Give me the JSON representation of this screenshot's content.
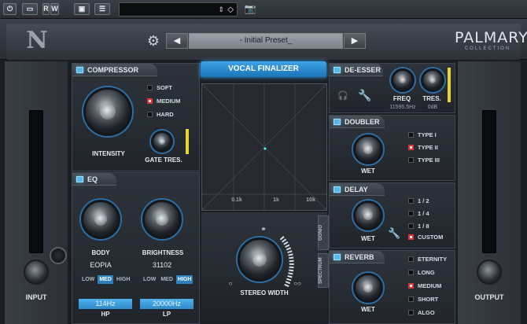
{
  "host": {
    "buttons": [
      "R",
      "W"
    ],
    "select_value": ""
  },
  "header": {
    "preset_name": "- Initial Preset_",
    "prev_arrow": "◀",
    "next_arrow": "▶",
    "brand_line1": "PALMARY",
    "brand_line2": "COLLECTION"
  },
  "input": {
    "label": "INPUT"
  },
  "output": {
    "label": "OUTPUT"
  },
  "title": "VOCAL FINALIZER",
  "compressor": {
    "title": "COMPRESSOR",
    "options": [
      "SOFT",
      "MEDIUM",
      "HARD"
    ],
    "selected": "MEDIUM",
    "intensity_label": "INTENSITY",
    "gate_label": "GATE TRES."
  },
  "eq": {
    "title": "EQ",
    "body_label": "BODY",
    "body_value": "EOPIA",
    "brightness_label": "BRIGHTNESS",
    "brightness_value": "31102",
    "body_bands": [
      "LOW",
      "MED",
      "HIGH"
    ],
    "body_selected": "MED",
    "brightness_bands": [
      "LOW",
      "MED",
      "HIGH"
    ],
    "brightness_selected": "HIGH",
    "hp_value": "114Hz",
    "hp_label": "HP",
    "lp_value": "20000Hz",
    "lp_label": "LP"
  },
  "display": {
    "freq_labels": [
      "0.1k",
      "1k",
      "10k"
    ],
    "tab_gonio": "GONIO",
    "tab_spectrum": "SPECTRUM"
  },
  "stereo": {
    "label": "STEREO WIDTH"
  },
  "deesser": {
    "title": "DE-ESSER",
    "freq_label": "FREQ",
    "freq_value": "11595.5Hz",
    "tres_label": "TRES.",
    "tres_value": "0dB"
  },
  "doubler": {
    "title": "DOUBLER",
    "wet_label": "WET",
    "options": [
      "TYPE I",
      "TYPE II",
      "TYPE III"
    ],
    "selected": "TYPE II"
  },
  "delay": {
    "title": "DELAY",
    "wet_label": "WET",
    "options": [
      "1 / 2",
      "1 / 4",
      "1 / 8",
      "CUSTOM"
    ],
    "selected": "CUSTOM"
  },
  "reverb": {
    "title": "REVERB",
    "wet_label": "WET",
    "options": [
      "ETERNITY",
      "LONG",
      "MEDIUM",
      "SHORT",
      "ALGO"
    ],
    "selected": "MEDIUM"
  },
  "colors": {
    "accent": "#3ca3e6",
    "led": "#58b8ea",
    "meter": "#e6d72a",
    "selected_option": "#d33"
  },
  "icons": [
    "power-icon",
    "compare-icon",
    "read-write-icon",
    "ab-icon",
    "menu-icon",
    "camera-icon",
    "gear-icon",
    "headphones-icon",
    "wrench-icon",
    "link-icon"
  ]
}
